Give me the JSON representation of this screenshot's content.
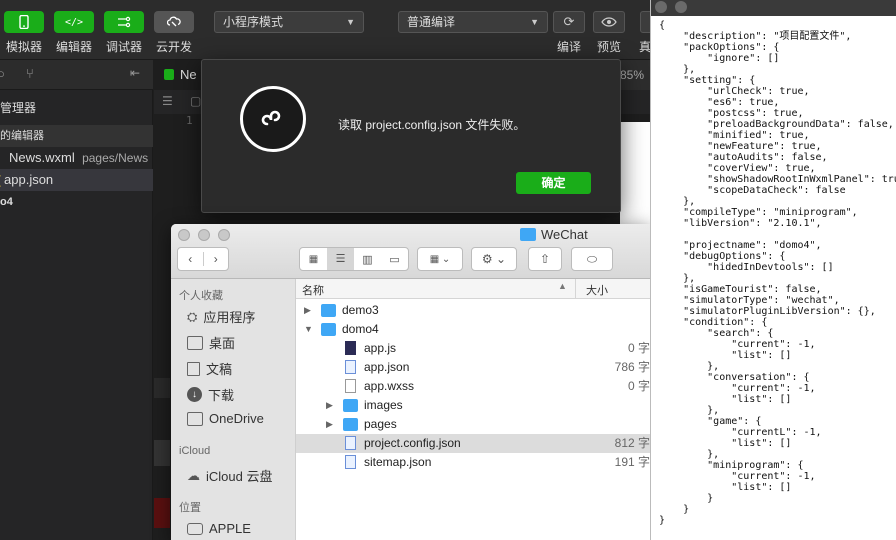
{
  "toolbar": {
    "buttons": [
      {
        "label": "模拟器",
        "icon": "phone-icon"
      },
      {
        "label": "编辑器",
        "icon": "code-icon"
      },
      {
        "label": "调试器",
        "icon": "debug-icon"
      },
      {
        "label": "云开发",
        "icon": "cloud-icon"
      }
    ],
    "mode_select": "小程序模式",
    "compile_select": "普通编译",
    "right_labels": [
      "编译",
      "预览",
      "真"
    ]
  },
  "sidebar": {
    "section_title": "管理器",
    "open_editors": "的编辑器",
    "open_files": [
      {
        "name": "News.wxml",
        "path": "pages/News"
      },
      {
        "name": "app.json",
        "path": ""
      }
    ],
    "project": "o4"
  },
  "editor": {
    "tab_label": "Ne",
    "zoom": "85%",
    "line_number": "1"
  },
  "dialog": {
    "message": "读取 project.config.json 文件失败。",
    "ok_label": "确定"
  },
  "finder": {
    "title": "WeChat",
    "sidebar": {
      "favorites_header": "个人收藏",
      "favorites": [
        "应用程序",
        "桌面",
        "文稿",
        "下载",
        "OneDrive"
      ],
      "icloud_header": "iCloud",
      "icloud": [
        "iCloud 云盘"
      ],
      "locations_header": "位置",
      "locations": [
        "APPLE"
      ]
    },
    "columns": {
      "name": "名称",
      "size": "大小"
    },
    "rows": [
      {
        "name": "demo3",
        "size": "",
        "type": "folder",
        "level": 0,
        "expanded": false
      },
      {
        "name": "domo4",
        "size": "",
        "type": "folder",
        "level": 0,
        "expanded": true
      },
      {
        "name": "app.js",
        "size": "0 字",
        "type": "js",
        "level": 1
      },
      {
        "name": "app.json",
        "size": "786 字",
        "type": "json",
        "level": 1
      },
      {
        "name": "app.wxss",
        "size": "0 字",
        "type": "file",
        "level": 1
      },
      {
        "name": "images",
        "size": "",
        "type": "folder",
        "level": 1,
        "expanded": false
      },
      {
        "name": "pages",
        "size": "",
        "type": "folder",
        "level": 1,
        "expanded": false
      },
      {
        "name": "project.config.json",
        "size": "812 字",
        "type": "json",
        "level": 1,
        "selected": true
      },
      {
        "name": "sitemap.json",
        "size": "191 字",
        "type": "json",
        "level": 1
      }
    ]
  },
  "json_view": {
    "text": "{\n    \"description\": \"项目配置文件\",\n    \"packOptions\": {\n        \"ignore\": []\n    },\n    \"setting\": {\n        \"urlCheck\": true,\n        \"es6\": true,\n        \"postcss\": true,\n        \"preloadBackgroundData\": false,\n        \"minified\": true,\n        \"newFeature\": true,\n        \"autoAudits\": false,\n        \"coverView\": true,\n        \"showShadowRootInWxmlPanel\": true,\n        \"scopeDataCheck\": false\n    },\n    \"compileType\": \"miniprogram\",\n    \"libVersion\": \"2.10.1\",\n\n    \"projectname\": \"domo4\",\n    \"debugOptions\": {\n        \"hidedInDevtools\": []\n    },\n    \"isGameTourist\": false,\n    \"simulatorType\": \"wechat\",\n    \"simulatorPluginLibVersion\": {},\n    \"condition\": {\n        \"search\": {\n            \"current\": -1,\n            \"list\": []\n        },\n        \"conversation\": {\n            \"current\": -1,\n            \"list\": []\n        },\n        \"game\": {\n            \"currentL\": -1,\n            \"list\": []\n        },\n        \"miniprogram\": {\n            \"current\": -1,\n            \"list\": []\n        }\n    }\n}"
  }
}
